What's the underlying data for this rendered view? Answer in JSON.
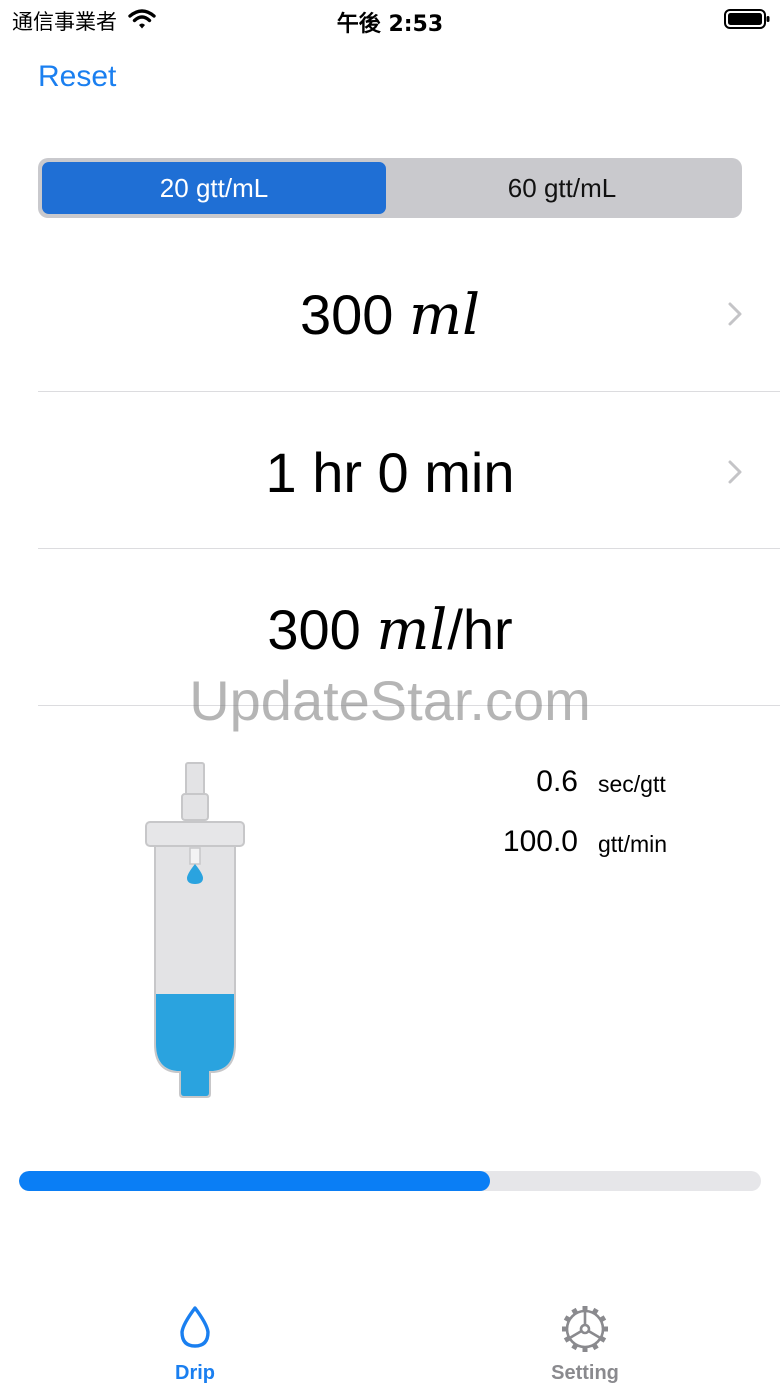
{
  "status_bar": {
    "carrier": "通信事業者",
    "time": "午後 2:53"
  },
  "header": {
    "reset_label": "Reset"
  },
  "drop_factor": {
    "options": [
      "20 gtt/mL",
      "60 gtt/mL"
    ],
    "selected_index": 0
  },
  "volume": {
    "number": "300",
    "unit": "ml"
  },
  "duration": {
    "text": "1 hr 0 min"
  },
  "flow_rate": {
    "number": "300",
    "unit": "ml",
    "suffix": "/hr"
  },
  "watermark": "UpdateStar.com",
  "rates": {
    "sec_per_drop_value": "0.6",
    "sec_per_drop_unit": "sec/gtt",
    "drops_per_min_value": "100.0",
    "drops_per_min_unit": "gtt/min"
  },
  "progress": {
    "fraction": 0.635
  },
  "tab_bar": {
    "tabs": [
      {
        "label": "Drip",
        "icon": "drop-icon",
        "active": true
      },
      {
        "label": "Setting",
        "icon": "gear-icon",
        "active": false
      }
    ]
  },
  "colors": {
    "accent": "#1a7ff0",
    "segment_selected": "#1f6fd5",
    "fluid": "#2aa3df",
    "progress": "#0a7ef5"
  }
}
